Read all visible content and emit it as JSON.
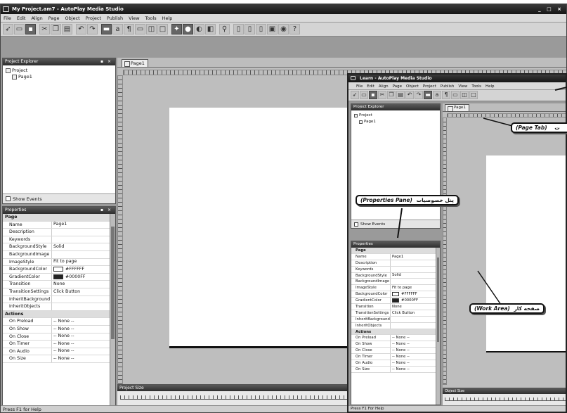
{
  "main": {
    "title": "My Project.am7 - AutoPlay Media Studio",
    "title_controls": "_ □ ×",
    "menu": [
      "File",
      "Edit",
      "Align",
      "Page",
      "Object",
      "Project",
      "Publish",
      "View",
      "Tools",
      "Help"
    ],
    "page_tab": "Page1",
    "project_explorer": {
      "title": "Project Explorer",
      "controls": "▪ ×",
      "root": "Project",
      "child": "Page1"
    },
    "show_events": "Show Events",
    "properties": {
      "title": "Properties",
      "controls": "▪ ×",
      "rows": [
        {
          "type": "cat",
          "key": "Page",
          "value": ""
        },
        {
          "type": "row",
          "key": "Name",
          "value": "Page1"
        },
        {
          "type": "row",
          "key": "Description",
          "value": ""
        },
        {
          "type": "row",
          "key": "Keywords",
          "value": ""
        },
        {
          "type": "row",
          "key": "BackgroundStyle",
          "value": "Solid"
        },
        {
          "type": "row",
          "key": "BackgroundImage",
          "value": ""
        },
        {
          "type": "row",
          "key": "ImageStyle",
          "value": "Fit to page"
        },
        {
          "type": "row",
          "key": "BackgroundColor",
          "value": "#FFFFFF",
          "swatch": "#FFFFFF"
        },
        {
          "type": "row",
          "key": "GradientColor",
          "value": "#0000FF",
          "swatch": "#222222"
        },
        {
          "type": "row",
          "key": "Transition",
          "value": "None"
        },
        {
          "type": "row",
          "key": "TransitionSettings",
          "value": "Click Button"
        },
        {
          "type": "row",
          "key": "InheritBackground",
          "value": ""
        },
        {
          "type": "row",
          "key": "InheritObjects",
          "value": ""
        },
        {
          "type": "cat",
          "key": "Actions",
          "value": ""
        },
        {
          "type": "row",
          "key": "On Preload",
          "value": "-- None --"
        },
        {
          "type": "row",
          "key": "On Show",
          "value": "-- None --"
        },
        {
          "type": "row",
          "key": "On Close",
          "value": "-- None --"
        },
        {
          "type": "row",
          "key": "On Timer",
          "value": "-- None --"
        },
        {
          "type": "row",
          "key": "On Audio",
          "value": "-- None --"
        },
        {
          "type": "row",
          "key": "On Size",
          "value": "-- None --"
        }
      ]
    },
    "project_size": "Project Size",
    "status": "Press F1 for Help"
  },
  "inset": {
    "title": "Learn - AutoPlay Media Studio",
    "menu": [
      "File",
      "Edit",
      "Align",
      "Page",
      "Object",
      "Project",
      "Publish",
      "View",
      "Tools",
      "Help"
    ],
    "page_tab": "Page1",
    "project_explorer": {
      "title": "Project Explorer",
      "root": "Project",
      "child": "Page1"
    },
    "show_events": "Show Events",
    "properties": {
      "title": "Properties",
      "rows": [
        {
          "type": "cat",
          "key": "Page",
          "value": ""
        },
        {
          "type": "row",
          "key": "Name",
          "value": "Page1"
        },
        {
          "type": "row",
          "key": "Description",
          "value": ""
        },
        {
          "type": "row",
          "key": "Keywords",
          "value": ""
        },
        {
          "type": "row",
          "key": "BackgroundStyle",
          "value": "Solid"
        },
        {
          "type": "row",
          "key": "BackgroundImage",
          "value": ""
        },
        {
          "type": "row",
          "key": "ImageStyle",
          "value": "Fit to page"
        },
        {
          "type": "row",
          "key": "BackgroundColor",
          "value": "#FFFFFF",
          "swatch": "#FFFFFF"
        },
        {
          "type": "row",
          "key": "GradientColor",
          "value": "#0000FF",
          "swatch": "#222222"
        },
        {
          "type": "row",
          "key": "Transition",
          "value": "None"
        },
        {
          "type": "row",
          "key": "TransitionSettings",
          "value": "Click Button"
        },
        {
          "type": "row",
          "key": "InheritBackground",
          "value": ""
        },
        {
          "type": "row",
          "key": "InheritObjects",
          "value": ""
        },
        {
          "type": "cat",
          "key": "Actions",
          "value": ""
        },
        {
          "type": "row",
          "key": "On Preload",
          "value": "-- None --"
        },
        {
          "type": "row",
          "key": "On Show",
          "value": "-- None --"
        },
        {
          "type": "row",
          "key": "On Close",
          "value": "-- None --"
        },
        {
          "type": "row",
          "key": "On Timer",
          "value": "-- None --"
        },
        {
          "type": "row",
          "key": "On Audio",
          "value": "-- None --"
        },
        {
          "type": "row",
          "key": "On Size",
          "value": "-- None --"
        }
      ]
    },
    "project_size": "Object Size",
    "status": "Press F1 For Help",
    "callouts": {
      "page_tab": {
        "en": "(Page Tab)",
        "fa": "ت"
      },
      "properties_pane": {
        "en": "(Properties Pane)",
        "fa": "پنل خصوصیات"
      },
      "work_area": {
        "en": "(Work Area)",
        "fa": "صفحه کار"
      }
    }
  }
}
